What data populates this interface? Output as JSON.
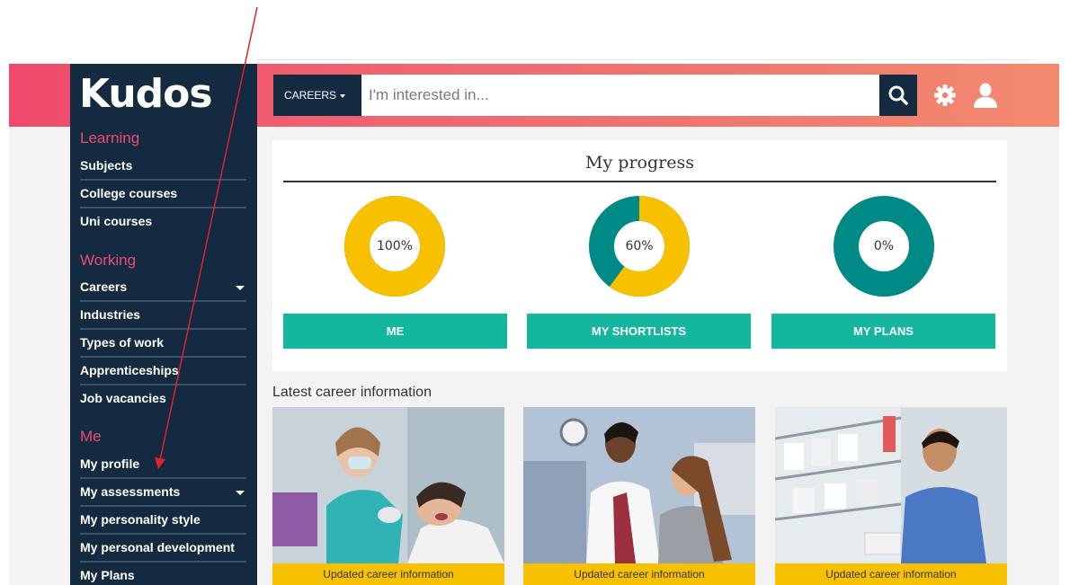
{
  "brand": {
    "logo": "Kudos"
  },
  "header": {
    "category_label": "CAREERS",
    "search_placeholder": "I'm interested in...",
    "icons": [
      "search-icon",
      "gear-icon",
      "user-icon"
    ]
  },
  "sidebar": {
    "learning": {
      "heading": "Learning",
      "items": [
        "Subjects",
        "College courses",
        "Uni courses"
      ]
    },
    "working": {
      "heading": "Working",
      "items": [
        "Careers",
        "Industries",
        "Types of work",
        "Apprenticeships",
        "Job vacancies"
      ]
    },
    "me": {
      "heading": "Me",
      "items": [
        "My profile",
        "My assessments",
        "My personality style",
        "My personal development",
        "My Plans"
      ]
    }
  },
  "progress": {
    "title": "My progress",
    "items": [
      {
        "label": "100%",
        "value": 100,
        "button": "ME"
      },
      {
        "label": "60%",
        "value": 60,
        "button": "MY SHORTLISTS"
      },
      {
        "label": "0%",
        "value": 0,
        "button": "MY PLANS"
      }
    ]
  },
  "latest": {
    "heading": "Latest career information",
    "cards": [
      {
        "caption": "Updated career information"
      },
      {
        "caption": "Updated career information"
      },
      {
        "caption": "Updated career information"
      }
    ]
  },
  "colors": {
    "sidebar": "#132a40",
    "accent_pink": "#ef4b6e",
    "teal_button": "#14b79d",
    "donut_fill": "#f8c100",
    "donut_track": "#008a87",
    "caption_bar": "#f8c100",
    "annotation_arrow": "#e0232b"
  }
}
